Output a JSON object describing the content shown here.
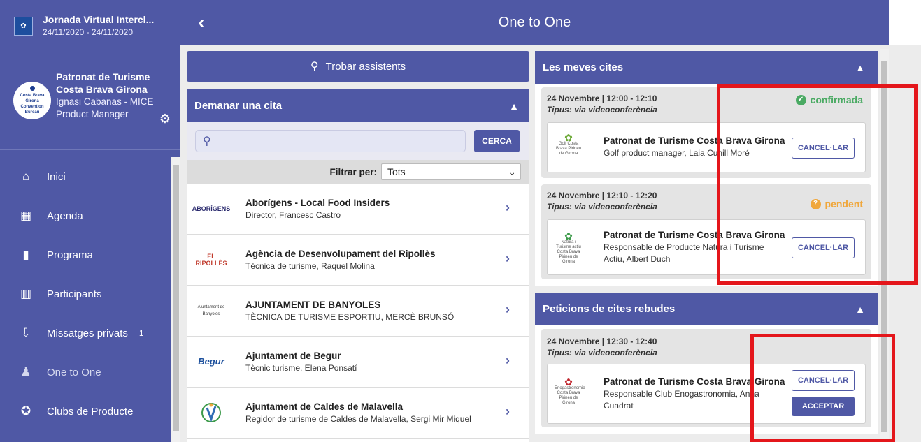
{
  "event": {
    "title": "Jornada Virtual Intercl...",
    "dates": "24/11/2020 - 24/11/2020",
    "logo_text": "Costa Brava Pirineu de Girona"
  },
  "profile": {
    "org_line1": "Patronat de Turisme",
    "org_line2": "Costa Brava Girona",
    "person_line1": "Ignasi Cabanas - MICE",
    "person_line2": "Product Manager",
    "avatar_line1": "Costa Brava Girona",
    "avatar_line2": "Convention Bureau"
  },
  "nav": [
    {
      "label": "Inici",
      "icon": "home-icon"
    },
    {
      "label": "Agenda",
      "icon": "calendar-check-icon"
    },
    {
      "label": "Programa",
      "icon": "document-icon"
    },
    {
      "label": "Participants",
      "icon": "building-icon"
    },
    {
      "label": "Missatges privats",
      "icon": "inbox-download-icon",
      "badge": "1"
    },
    {
      "label": "One to One",
      "icon": "people-icon"
    },
    {
      "label": "Clubs de Producte",
      "icon": "gear-badge-icon"
    }
  ],
  "topbar": {
    "title": "One to One"
  },
  "find": {
    "label": "Trobar assistents"
  },
  "request": {
    "title": "Demanar una cita",
    "search_placeholder": "",
    "search_button": "CERCA",
    "filter_label": "Filtrar per:",
    "filter_value": "Tots",
    "attendees": [
      {
        "name": "Aborígens - Local Food Insiders",
        "role": "Director, Francesc Castro",
        "logo": "ABORÍGENS"
      },
      {
        "name": "Agència de Desenvolupament del Ripollès",
        "role": "Tècnica de turisme, Raquel Molina",
        "logo": "EL RIPOLLÈS"
      },
      {
        "name": "AJUNTAMENT DE BANYOLES",
        "role": "TÈCNICA DE TURISME ESPORTIU, MERCÈ BRUNSÓ",
        "logo": "Ajuntament de Banyoles"
      },
      {
        "name": "Ajuntament de Begur",
        "role": "Tècnic turisme, Elena Ponsatí",
        "logo": "Begur"
      },
      {
        "name": "Ajuntament de Caldes de Malavella",
        "role": "Regidor de turisme de Caldes de Malavella, Sergi Mir Miquel",
        "logo": ""
      }
    ]
  },
  "my_appointments": {
    "title": "Les meves cites",
    "items": [
      {
        "date": "24 Novembre | 12:00 - 12:10",
        "type": "Tipus: via videoconferència",
        "status": "confirmada",
        "org": "Patronat de Turisme Costa Brava Girona",
        "role_line1": "Golf product manager, Laia Cunill Moré",
        "role_line2": "",
        "logo": "Golf Costa Brava Pirineu de Girona",
        "cancel": "CANCEL·LAR"
      },
      {
        "date": "24 Novembre | 12:10 - 12:20",
        "type": "Tipus: via videoconferència",
        "status": "pendent",
        "org": "Patronat de Turisme Costa Brava Girona",
        "role_line1": "Responsable de Producte Natura i Turisme",
        "role_line2": "Actiu, Albert Duch",
        "logo": "Natura i Turisme actiu Costa Brava Pirineu de Girona",
        "cancel": "CANCEL·LAR"
      }
    ]
  },
  "received_requests": {
    "title": "Peticions de cites rebudes",
    "items": [
      {
        "date": "24 Novembre | 12:30 - 12:40",
        "type": "Tipus: via videoconferència",
        "org": "Patronat de Turisme Costa Brava Girona",
        "role_line1": "Responsable Club Enogastronomia, Anna",
        "role_line2": "Cuadrat",
        "logo": "Enogastronomia Costa Brava Pirineu de Girona",
        "cancel": "CANCEL·LAR",
        "accept": "ACCEPTAR"
      }
    ]
  },
  "colors": {
    "primary": "#4f58a5",
    "confirmed": "#4aaa63",
    "pending": "#f0a73b",
    "highlight": "#e4161b"
  }
}
